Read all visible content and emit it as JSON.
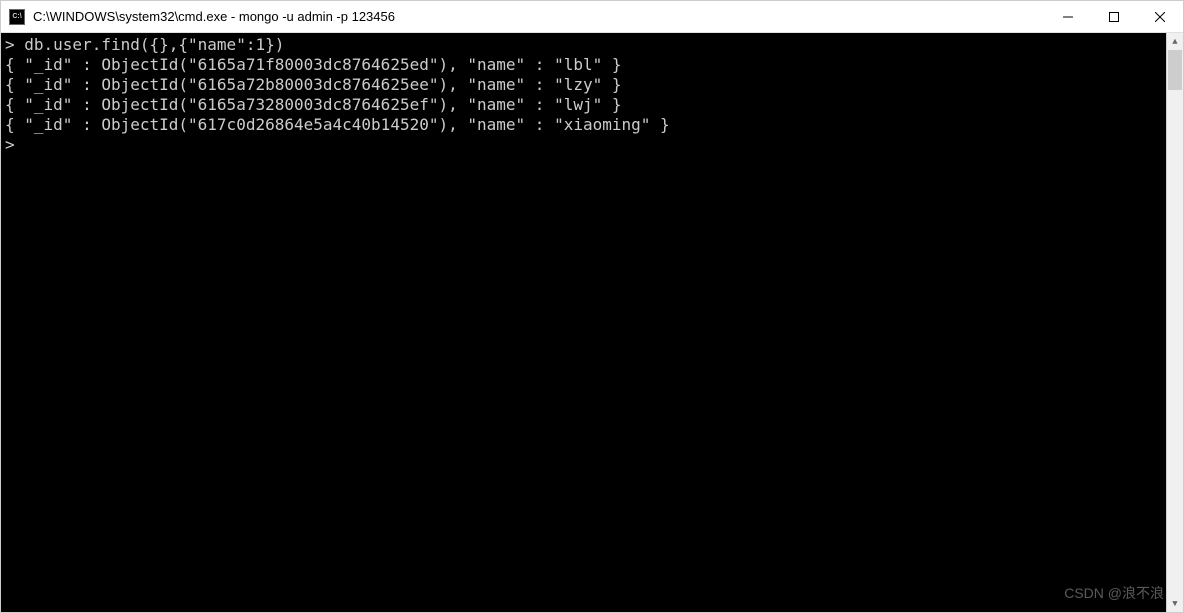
{
  "window": {
    "title": "C:\\WINDOWS\\system32\\cmd.exe - mongo  -u admin -p 123456",
    "icon_label": "C:\\"
  },
  "console": {
    "prompt_char": ">",
    "command": "db.user.find({},{\"name\":1})",
    "results": [
      {
        "_id": "6165a71f80003dc8764625ed",
        "name": "lbl"
      },
      {
        "_id": "6165a72b80003dc8764625ee",
        "name": "lzy"
      },
      {
        "_id": "6165a73280003dc8764625ef",
        "name": "lwj"
      },
      {
        "_id": "617c0d26864e5a4c40b14520",
        "name": "xiaoming"
      }
    ]
  },
  "watermark": "CSDN @浪不浪"
}
